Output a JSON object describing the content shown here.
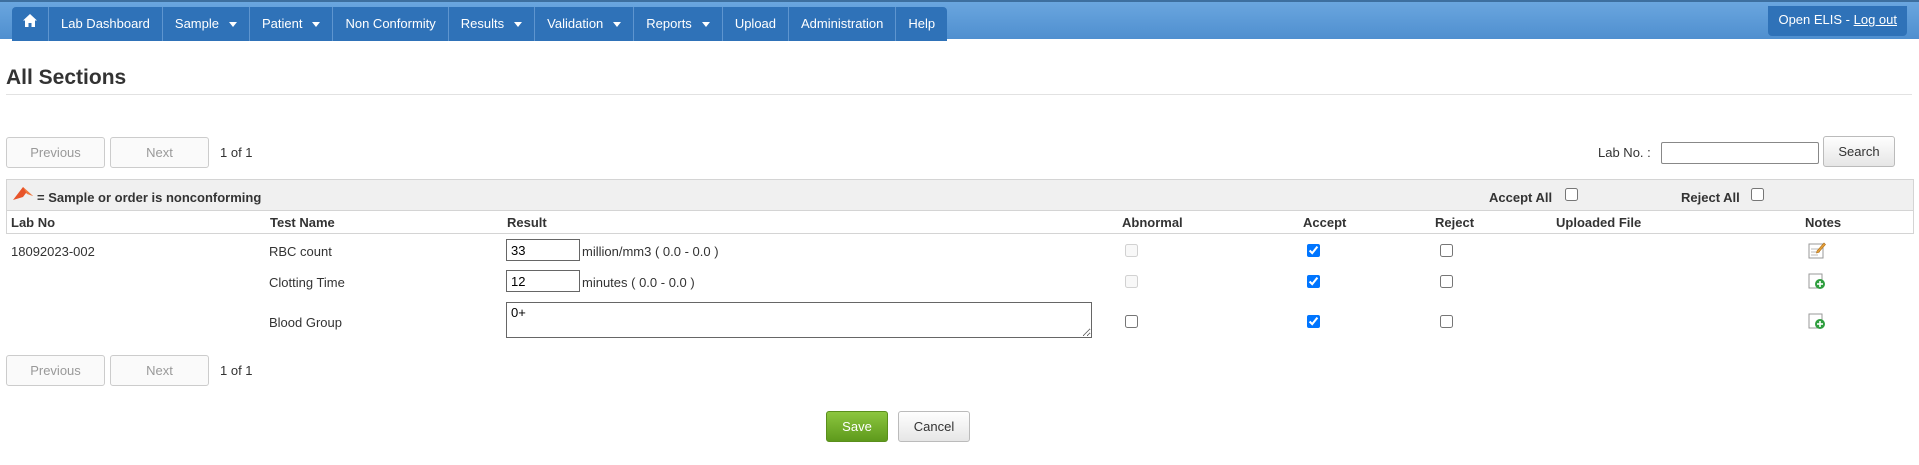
{
  "nav": {
    "home_icon": "home-icon",
    "items": [
      {
        "label": "Lab Dashboard",
        "has_caret": false
      },
      {
        "label": "Sample",
        "has_caret": true
      },
      {
        "label": "Patient",
        "has_caret": true
      },
      {
        "label": "Non Conformity",
        "has_caret": false
      },
      {
        "label": "Results",
        "has_caret": true
      },
      {
        "label": "Validation",
        "has_caret": true
      },
      {
        "label": "Reports",
        "has_caret": true
      },
      {
        "label": "Upload",
        "has_caret": false
      },
      {
        "label": "Administration",
        "has_caret": false
      },
      {
        "label": "Help",
        "has_caret": false
      }
    ],
    "brand": "Open ELIS - ",
    "logout": "Log out"
  },
  "page_title": "All Sections",
  "pagination": {
    "previous": "Previous",
    "next": "Next",
    "info": "1 of 1"
  },
  "search": {
    "label": "Lab No. :",
    "value": "",
    "button": "Search"
  },
  "legend": {
    "text": "= Sample or order is nonconforming",
    "flag_icon": "nonconforming-flag-icon",
    "accept_all": "Accept All",
    "reject_all": "Reject All"
  },
  "columns": {
    "lab_no": "Lab No",
    "test_name": "Test Name",
    "result": "Result",
    "abnormal": "Abnormal",
    "accept": "Accept",
    "reject": "Reject",
    "uploaded_file": "Uploaded File",
    "notes": "Notes"
  },
  "rows": [
    {
      "lab_no": "18092023-002",
      "test_name": "RBC count",
      "result": "33",
      "unit": "million/mm3 ( 0.0 - 0.0 )",
      "abnormal": false,
      "abnormal_disabled": true,
      "accept": true,
      "reject": false,
      "notes_icon": "edit-note-icon"
    },
    {
      "lab_no": "",
      "test_name": "Clotting Time",
      "result": "12",
      "unit": "minutes ( 0.0 - 0.0 )",
      "abnormal": false,
      "abnormal_disabled": true,
      "accept": true,
      "reject": false,
      "notes_icon": "add-note-icon"
    },
    {
      "lab_no": "",
      "test_name": "Blood Group",
      "result": "0+",
      "unit": "",
      "abnormal": false,
      "abnormal_disabled": false,
      "accept": true,
      "reject": false,
      "notes_icon": "add-note-icon"
    }
  ],
  "actions": {
    "save": "Save",
    "cancel": "Cancel"
  },
  "colors": {
    "nav_bar": "#5b9bd5",
    "nav_menu": "#2f72b8",
    "save_green": "#6faa26"
  }
}
